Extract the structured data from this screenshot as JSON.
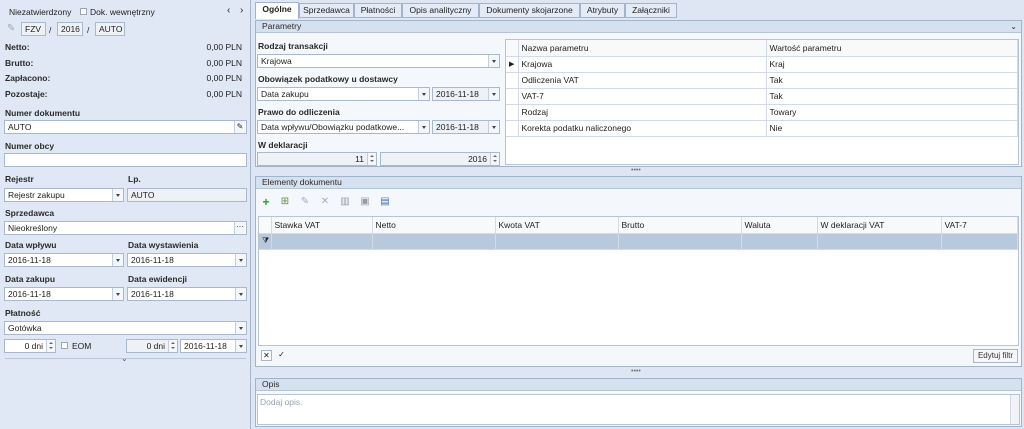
{
  "header": {
    "status": "Niezatwierdzony",
    "internal_doc": "Dok. wewnętrzny",
    "doc_type": "FZV",
    "year": "2016",
    "number": "AUTO",
    "sep": "/"
  },
  "summary": [
    {
      "label": "Netto:",
      "value": "0,00 PLN"
    },
    {
      "label": "Brutto:",
      "value": "0,00 PLN"
    },
    {
      "label": "Zapłacono:",
      "value": "0,00 PLN"
    },
    {
      "label": "Pozostaje:",
      "value": "0,00 PLN"
    }
  ],
  "left": {
    "doc_number_label": "Numer dokumentu",
    "doc_number": "AUTO",
    "foreign_number_label": "Numer obcy",
    "foreign_number": "",
    "register_label": "Rejestr",
    "register": "Rejestr zakupu",
    "lp_label": "Lp.",
    "lp": "AUTO",
    "seller_label": "Sprzedawca",
    "seller": "Nieokreślony",
    "receipt_date_label": "Data wpływu",
    "receipt_date": "2016-11-18",
    "issue_date_label": "Data wystawienia",
    "issue_date": "2016-11-18",
    "purchase_date_label": "Data zakupu",
    "purchase_date": "2016-11-18",
    "record_date_label": "Data ewidencji",
    "record_date": "2016-11-18",
    "payment_label": "Płatność",
    "payment": "Gotówka",
    "days1": "0 dni",
    "eom": "EOM",
    "days2": "0 dni",
    "due_date": "2016-11-18"
  },
  "tabs": [
    "Ogólne",
    "Sprzedawca",
    "Płatności",
    "Opis analityczny",
    "Dokumenty skojarzone",
    "Atrybuty",
    "Załączniki"
  ],
  "params": {
    "title": "Parametry",
    "transaction_label": "Rodzaj transakcji",
    "transaction": "Krajowa",
    "tax_duty_label": "Obowiązek podatkowy u dostawcy",
    "tax_duty": "Data zakupu",
    "tax_duty_date": "2016-11-18",
    "deduction_label": "Prawo do odliczenia",
    "deduction": "Data wpływu/Obowiązku podatkowe...",
    "deduction_date": "2016-11-18",
    "declaration_label": "W deklaracji",
    "decl_month": "11",
    "decl_year": "2016",
    "table_headers": [
      "Nazwa parametru",
      "Wartość parametru"
    ],
    "rows": [
      {
        "name": "Krajowa",
        "value": "Kraj"
      },
      {
        "name": "Odliczenia VAT",
        "value": "Tak"
      },
      {
        "name": "VAT-7",
        "value": "Tak"
      },
      {
        "name": "Rodzaj",
        "value": "Towary"
      },
      {
        "name": "Korekta podatku naliczonego",
        "value": "Nie"
      }
    ]
  },
  "elements": {
    "title": "Elementy dokumentu",
    "headers": [
      "Stawka VAT",
      "Netto",
      "Kwota VAT",
      "Brutto",
      "Waluta",
      "W deklaracji VAT",
      "VAT-7"
    ],
    "edit_filter": "Edytuj filtr"
  },
  "desc": {
    "title": "Opis",
    "placeholder": "Dodaj opis."
  }
}
